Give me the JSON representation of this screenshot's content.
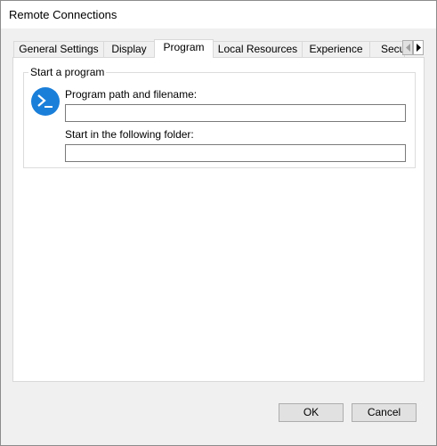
{
  "window": {
    "title": "Remote Connections"
  },
  "tabs": [
    {
      "label": "General Settings",
      "active": false
    },
    {
      "label": "Display",
      "active": false
    },
    {
      "label": "Program",
      "active": true
    },
    {
      "label": "Local Resources",
      "active": false
    },
    {
      "label": "Experience",
      "active": false
    },
    {
      "label": "Secu",
      "active": false
    }
  ],
  "program": {
    "group_title": "Start a program",
    "icon": "powershell-prompt-icon",
    "path_label": "Program path and filename:",
    "path_value": "",
    "folder_label": "Start in the following folder:",
    "folder_value": ""
  },
  "buttons": {
    "ok": "OK",
    "cancel": "Cancel"
  },
  "colors": {
    "accent": "#1a7fd9"
  }
}
